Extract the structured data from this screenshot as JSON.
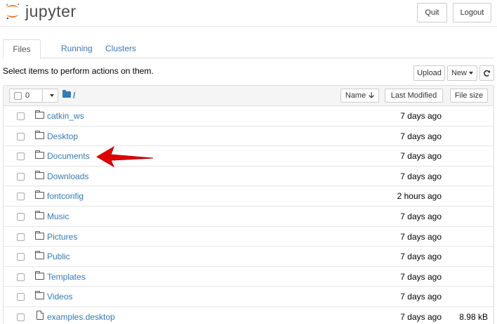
{
  "header": {
    "logo_text": "jupyter",
    "quit_label": "Quit",
    "logout_label": "Logout"
  },
  "tabs": [
    {
      "label": "Files"
    },
    {
      "label": "Running"
    },
    {
      "label": "Clusters"
    }
  ],
  "toolbar": {
    "hint": "Select items to perform actions on them.",
    "upload_label": "Upload",
    "new_label": "New",
    "refresh_icon": "refresh-icon"
  },
  "list_header": {
    "selected_count": "0",
    "breadcrumb": "/",
    "name_label": "Name",
    "last_modified_label": "Last Modified",
    "file_size_label": "File size"
  },
  "files": [
    {
      "name": "catkin_ws",
      "type": "folder",
      "modified": "7 days ago",
      "size": ""
    },
    {
      "name": "Desktop",
      "type": "folder",
      "modified": "7 days ago",
      "size": ""
    },
    {
      "name": "Documents",
      "type": "folder",
      "modified": "7 days ago",
      "size": ""
    },
    {
      "name": "Downloads",
      "type": "folder",
      "modified": "7 days ago",
      "size": ""
    },
    {
      "name": "fontconfig",
      "type": "folder",
      "modified": "2 hours ago",
      "size": ""
    },
    {
      "name": "Music",
      "type": "folder",
      "modified": "7 days ago",
      "size": ""
    },
    {
      "name": "Pictures",
      "type": "folder",
      "modified": "7 days ago",
      "size": ""
    },
    {
      "name": "Public",
      "type": "folder",
      "modified": "7 days ago",
      "size": ""
    },
    {
      "name": "Templates",
      "type": "folder",
      "modified": "7 days ago",
      "size": ""
    },
    {
      "name": "Videos",
      "type": "folder",
      "modified": "7 days ago",
      "size": ""
    },
    {
      "name": "examples.desktop",
      "type": "file",
      "modified": "7 days ago",
      "size": "8.98 kB"
    }
  ],
  "colors": {
    "link": "#337ab7",
    "logo_orange": "#f37726",
    "annotation_red": "#e00000"
  }
}
